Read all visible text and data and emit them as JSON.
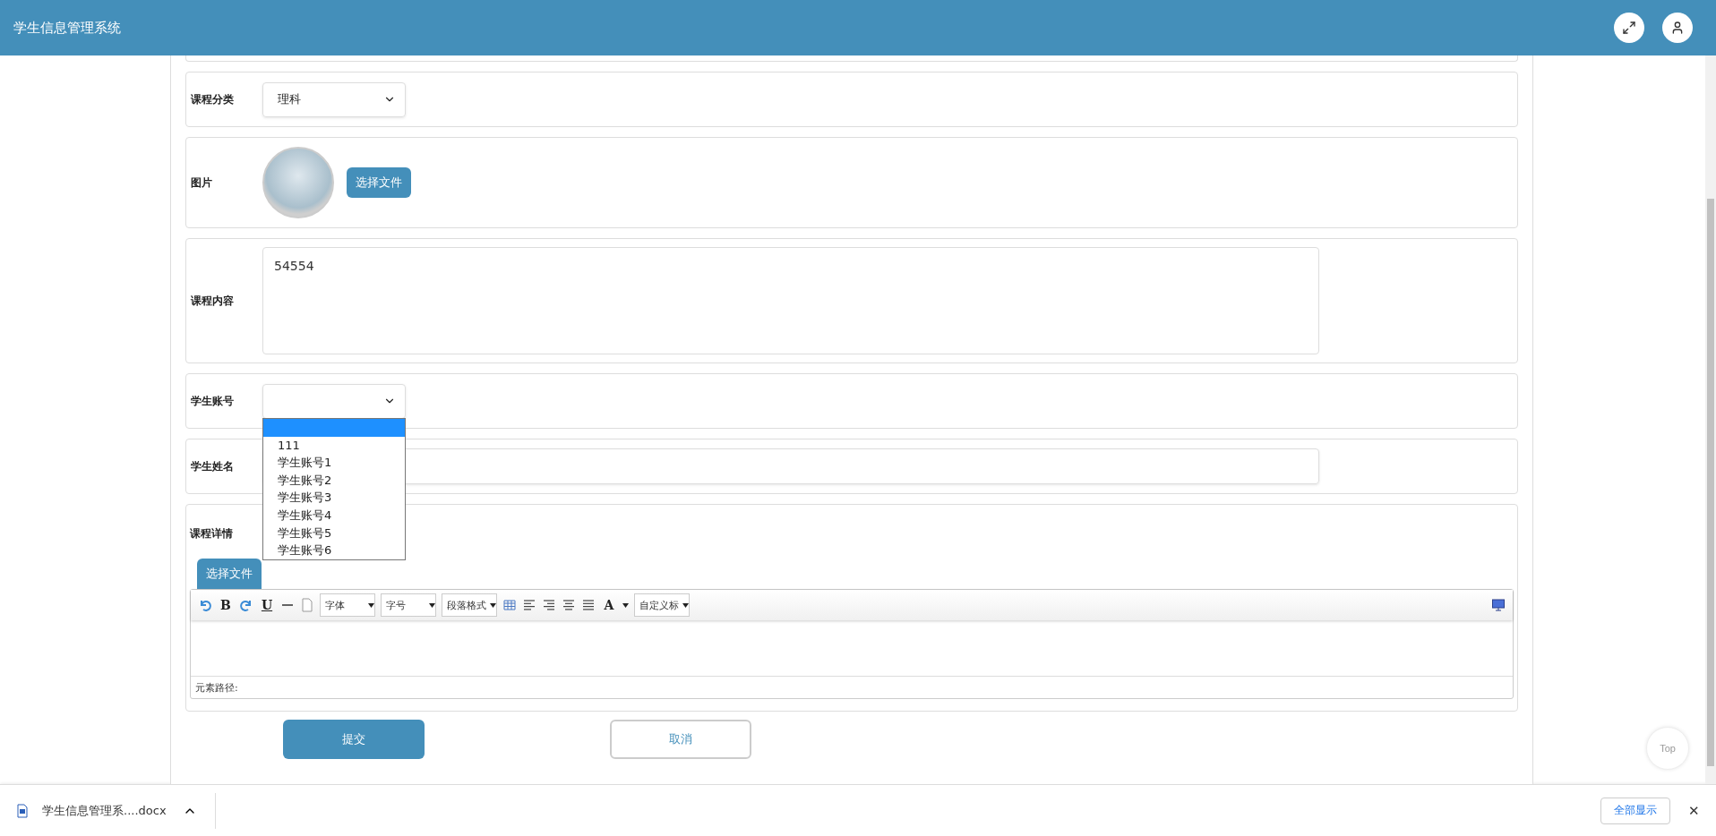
{
  "header": {
    "title": "学生信息管理系统"
  },
  "form": {
    "rows": [
      {
        "kind": "select",
        "label": "课程分类",
        "value": "理科"
      },
      {
        "kind": "image",
        "label": "图片",
        "button": "选择文件"
      },
      {
        "kind": "textarea",
        "label": "课程内容",
        "value": "54554"
      },
      {
        "kind": "open-select",
        "label": "学生账号",
        "options": [
          {
            "selected": true
          },
          {
            "label": "111",
            "selected": false
          },
          {
            "label": "学生账号1",
            "selected": false
          },
          {
            "label": "学生账号2",
            "selected": false
          },
          {
            "label": "学生账号3",
            "selected": false
          },
          {
            "label": "学生账号4",
            "selected": false
          },
          {
            "label": "学生账号5",
            "selected": false
          },
          {
            "label": "学生账号6",
            "selected": false
          }
        ]
      },
      {
        "kind": "input",
        "label": "学生姓名"
      },
      {
        "kind": "editor",
        "label": "课程详情",
        "button": "选择文件",
        "path_label": "元素路径:",
        "toolbar": [
          {
            "kind": "undo"
          },
          {
            "kind": "bold",
            "label": "B"
          },
          {
            "kind": "redo"
          },
          {
            "kind": "underline",
            "label": "U"
          },
          {
            "kind": "rule"
          },
          {
            "kind": "page"
          },
          {
            "kind": "combo",
            "label": "字体"
          },
          {
            "kind": "combo",
            "label": "字号"
          },
          {
            "kind": "combo",
            "label": "段落格式"
          },
          {
            "kind": "table"
          },
          {
            "kind": "align-left"
          },
          {
            "kind": "align-right"
          },
          {
            "kind": "align-center"
          },
          {
            "kind": "justify"
          },
          {
            "kind": "color",
            "label": "A"
          },
          {
            "kind": "combo",
            "label": "自定义标"
          }
        ]
      }
    ],
    "submit": "提交",
    "cancel": "取消"
  },
  "top_button": "Top",
  "download_bar": {
    "file": "学生信息管理系....docx",
    "show_all": "全部显示",
    "close": "✕"
  }
}
